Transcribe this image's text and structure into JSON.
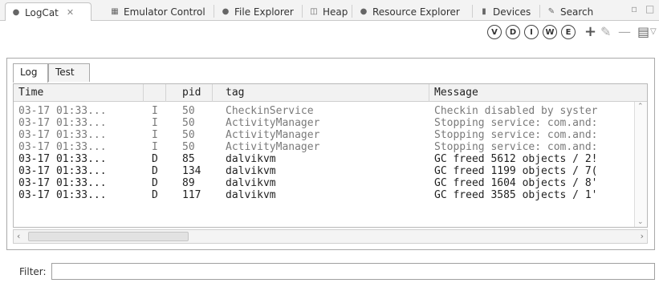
{
  "view_tabs": [
    {
      "label": "LogCat",
      "icon": "logcat-icon",
      "active": true
    },
    {
      "label": "Emulator Control",
      "icon": "emulator-icon"
    },
    {
      "label": "File Explorer",
      "icon": "file-explorer-icon"
    },
    {
      "label": "Heap",
      "icon": "heap-icon"
    },
    {
      "label": "Resource Explorer",
      "icon": "resource-explorer-icon"
    },
    {
      "label": "Devices",
      "icon": "devices-icon"
    },
    {
      "label": "Search",
      "icon": "search-icon"
    }
  ],
  "toolbar": {
    "level_buttons": [
      "V",
      "D",
      "I",
      "W",
      "E"
    ]
  },
  "subtabs": [
    "Log",
    "Test"
  ],
  "table": {
    "columns": [
      "Time",
      "",
      "pid",
      "tag",
      "Message"
    ],
    "rows": [
      {
        "time": "03-17 01:33...",
        "level": "I",
        "pid": "50",
        "tag": "CheckinService",
        "message": "Checkin disabled by syster",
        "tone": "grey"
      },
      {
        "time": "03-17 01:33...",
        "level": "I",
        "pid": "50",
        "tag": "ActivityManager",
        "message": "Stopping service: com.and:",
        "tone": "grey"
      },
      {
        "time": "03-17 01:33...",
        "level": "I",
        "pid": "50",
        "tag": "ActivityManager",
        "message": "Stopping service: com.and:",
        "tone": "grey"
      },
      {
        "time": "03-17 01:33...",
        "level": "I",
        "pid": "50",
        "tag": "ActivityManager",
        "message": "Stopping service: com.and:",
        "tone": "grey"
      },
      {
        "time": "03-17 01:33...",
        "level": "D",
        "pid": "85",
        "tag": "dalvikvm",
        "message": "GC freed 5612 objects / 2!",
        "tone": "dark"
      },
      {
        "time": "03-17 01:33...",
        "level": "D",
        "pid": "134",
        "tag": "dalvikvm",
        "message": "GC freed 1199 objects / 7(",
        "tone": "dark"
      },
      {
        "time": "03-17 01:33...",
        "level": "D",
        "pid": "89",
        "tag": "dalvikvm",
        "message": "GC freed 1604 objects / 8'",
        "tone": "dark"
      },
      {
        "time": "03-17 01:33...",
        "level": "D",
        "pid": "117",
        "tag": "dalvikvm",
        "message": "GC freed 3585 objects / 1'",
        "tone": "dark"
      }
    ]
  },
  "filter": {
    "label": "Filter:",
    "value": ""
  }
}
